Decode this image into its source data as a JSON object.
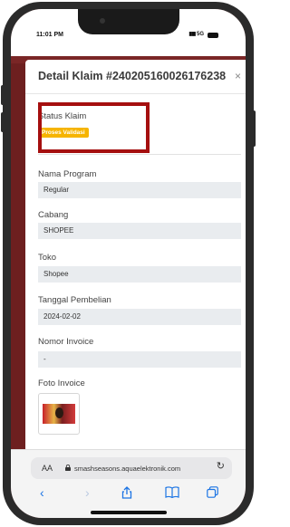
{
  "status_bar": {
    "time": "11:01 PM",
    "signal": "5G"
  },
  "modal": {
    "title": "Detail Klaim #240205160026176238",
    "close_label": "×",
    "status_label": "Status Klaim",
    "status_badge": "Proses Validasi",
    "fields": [
      {
        "label": "Nama Program",
        "value": "Regular"
      },
      {
        "label": "Cabang",
        "value": "SHOPEE"
      },
      {
        "label": "Toko",
        "value": "Shopee"
      },
      {
        "label": "Tanggal Pembelian",
        "value": "2024-02-02"
      },
      {
        "label": "Nomor Invoice",
        "value": "-"
      }
    ],
    "invoice_label": "Foto Invoice"
  },
  "browser": {
    "aa_label": "AA",
    "url": "smashseasons.aquaelektronik.com",
    "reload_icon": "reload-icon",
    "nav": [
      "back-icon",
      "forward-icon",
      "share-icon",
      "bookmarks-icon",
      "tabs-icon"
    ]
  },
  "colors": {
    "badge": "#f6b400",
    "highlight": "#a50f0f",
    "backdrop": "#6d1f1f",
    "accent": "#1b74e4"
  }
}
